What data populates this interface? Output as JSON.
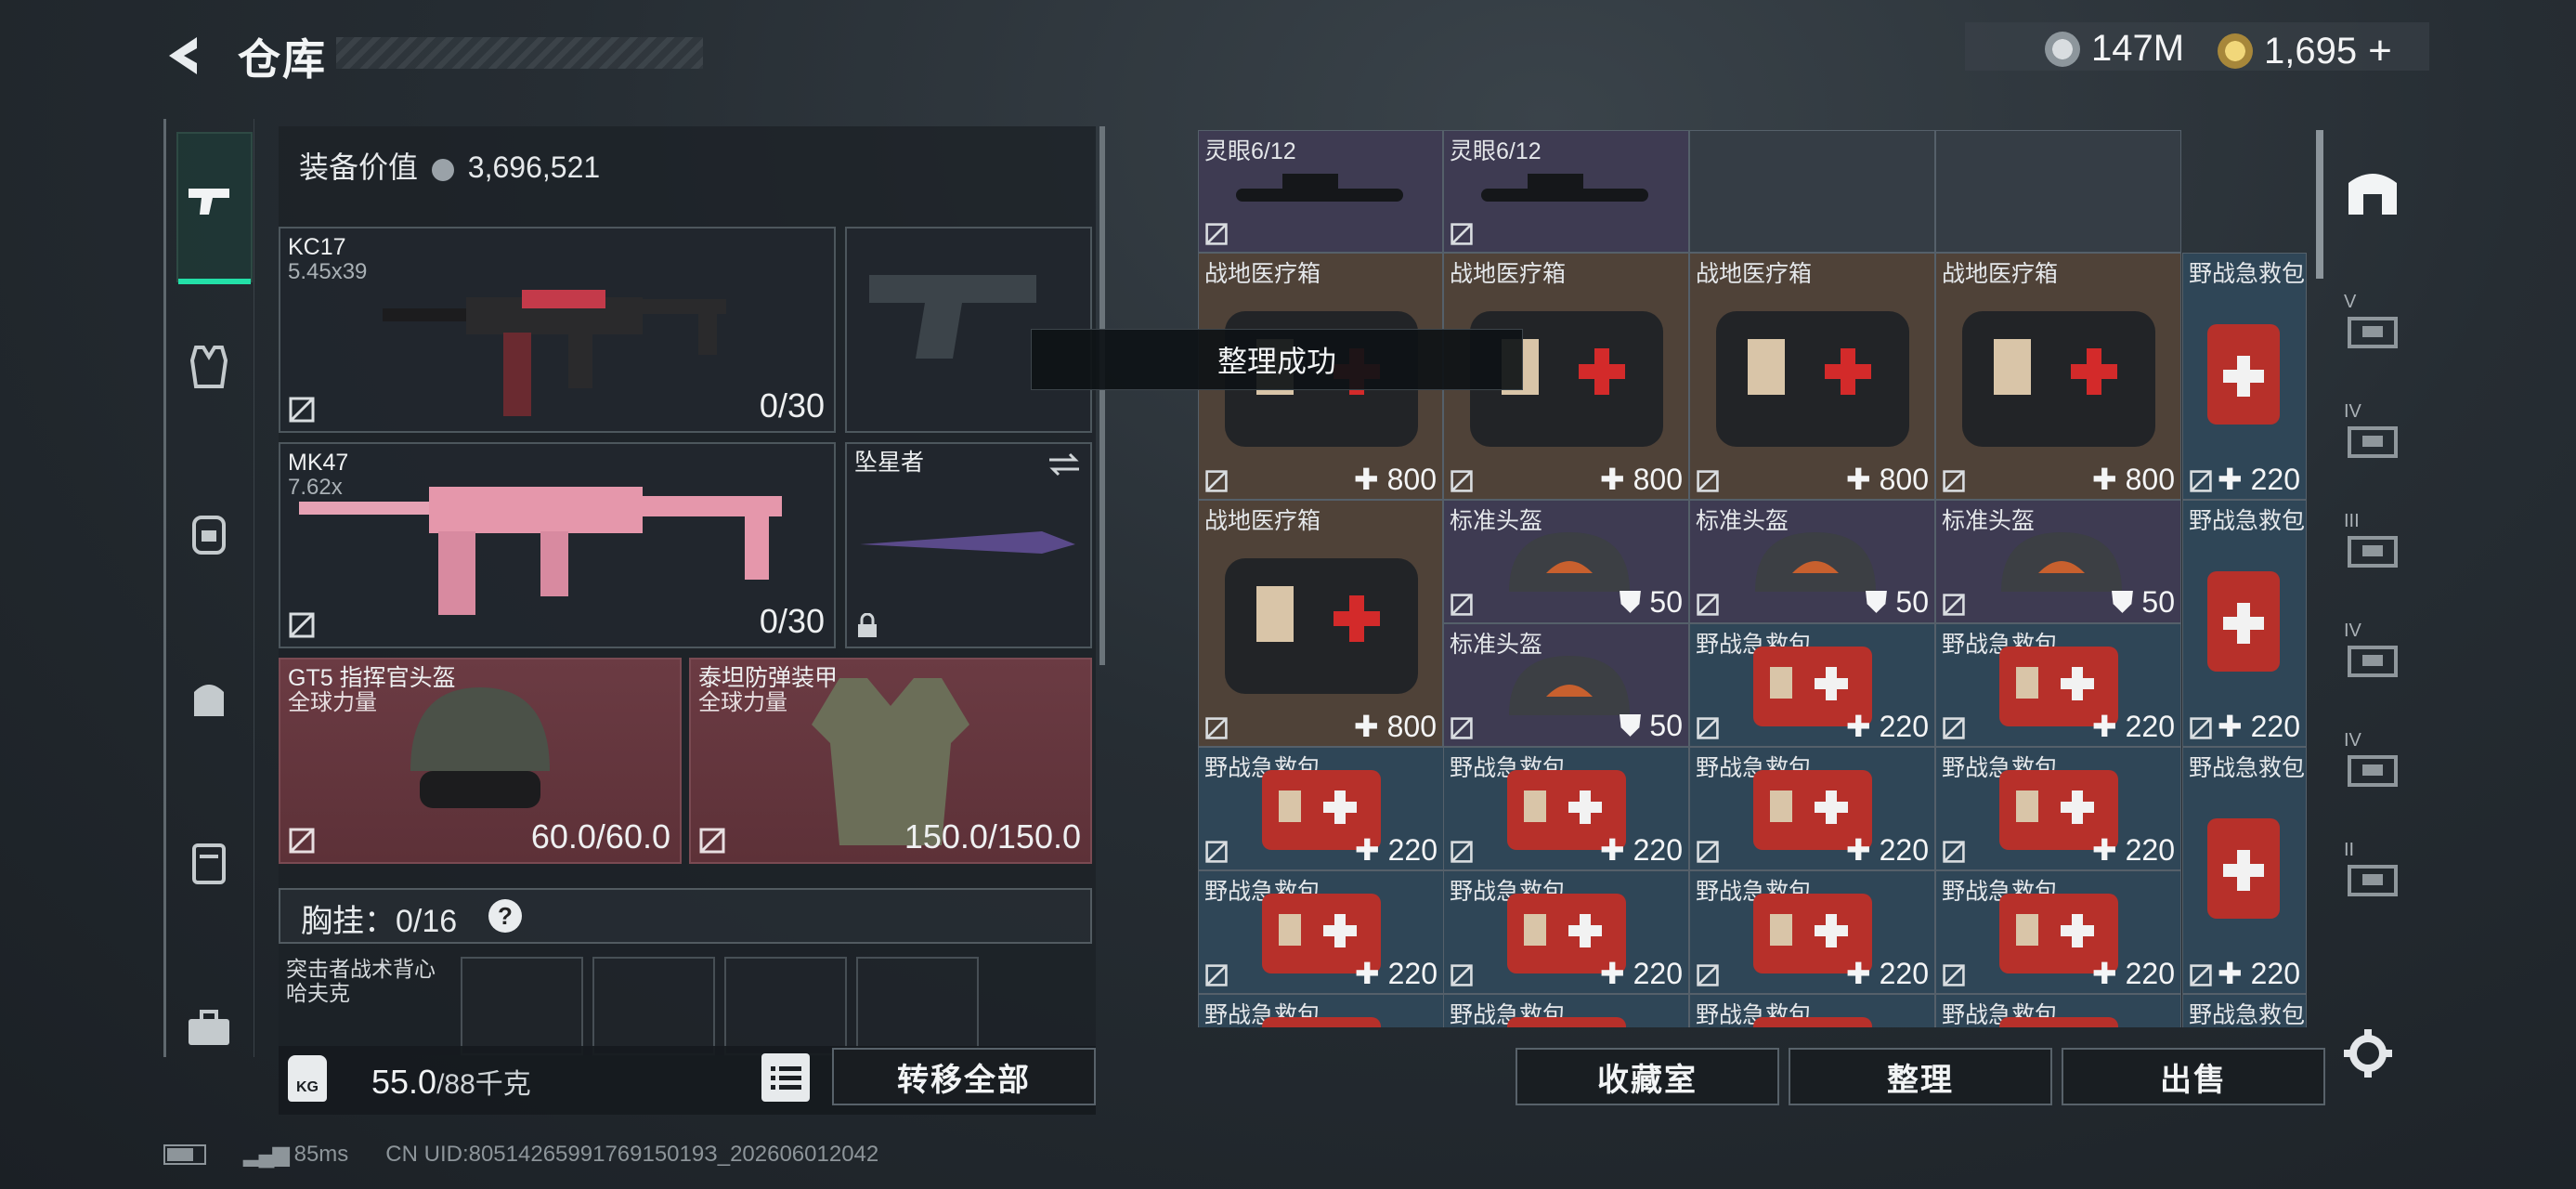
{
  "header": {
    "title": "仓库",
    "currency_silver": "147M",
    "currency_gold": "1,695"
  },
  "equip": {
    "value_label": "装备价值",
    "value": "3,696,521"
  },
  "slots": {
    "primary1": {
      "name": "KC17",
      "ammo_type": "5.45x39",
      "ammo": "0/30"
    },
    "primary2": {
      "name": "MK47",
      "ammo_type": "7.62x",
      "ammo": "0/30"
    },
    "melee": {
      "name": "坠星者"
    },
    "helmet": {
      "name": "GT5 指挥官头盔",
      "brand": "全球力量",
      "durability": "60.0/60.0"
    },
    "armor": {
      "name": "泰坦防弹装甲",
      "brand": "全球力量",
      "durability": "150.0/150.0"
    }
  },
  "chest": {
    "label": "胸挂：0/16",
    "help": "?",
    "rig_name": "突击者战术背心",
    "rig_sub": "哈夫克"
  },
  "bottom": {
    "weight": "55.0",
    "weight_max": "/88千克",
    "kg": "KG",
    "transfer_all": "转移全部"
  },
  "actions": {
    "vault": "收藏室",
    "sort": "整理",
    "sell": "出售"
  },
  "toast": "整理成功",
  "items": {
    "scope": "灵眼6/12",
    "medbox": "战地医疗箱",
    "firstaid": "野战急救包",
    "helmet": "标准头盔",
    "v800": "800",
    "v220": "220",
    "v50": "50"
  },
  "tabs": {
    "t1": "V",
    "t2": "IV",
    "t3": "III",
    "t4": "IV",
    "t5": "IV",
    "t6": "II"
  },
  "footer": {
    "ping": "85ms",
    "uid": "CN UID:8051426599176915019З_202606012042"
  },
  "colors": {
    "accent": "#23e0a8",
    "slot_red": "#6b3b43",
    "cell_blue": "#2f4657",
    "cell_brown": "#4f4238",
    "cell_purple": "#3e3b52"
  }
}
